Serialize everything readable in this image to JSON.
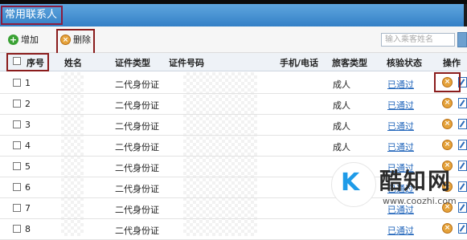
{
  "window": {
    "title": "常用联系人"
  },
  "toolbar": {
    "add_label": "增加",
    "delete_label": "删除",
    "search_placeholder": "输入乘客姓名"
  },
  "table": {
    "headers": {
      "seq": "序号",
      "name": "姓名",
      "id_type": "证件类型",
      "id_number": "证件号码",
      "phone": "手机/电话",
      "passenger_type": "旅客类型",
      "status": "核验状态",
      "action": "操作"
    },
    "rows": [
      {
        "seq": "1",
        "id_type": "二代身份证",
        "passenger_type": "成人",
        "status": "已通过"
      },
      {
        "seq": "2",
        "id_type": "二代身份证",
        "passenger_type": "成人",
        "status": "已通过"
      },
      {
        "seq": "3",
        "id_type": "二代身份证",
        "passenger_type": "成人",
        "status": "已通过"
      },
      {
        "seq": "4",
        "id_type": "二代身份证",
        "passenger_type": "成人",
        "status": "已通过"
      },
      {
        "seq": "5",
        "id_type": "二代身份证",
        "passenger_type": "",
        "status": "已通过"
      },
      {
        "seq": "6",
        "id_type": "二代身份证",
        "passenger_type": "",
        "status": "已通过"
      },
      {
        "seq": "7",
        "id_type": "二代身份证",
        "passenger_type": "",
        "status": "已通过"
      },
      {
        "seq": "8",
        "id_type": "二代身份证",
        "passenger_type": "",
        "status": "已通过"
      }
    ]
  },
  "watermark": {
    "logo_letter": "K",
    "name": "酷知网",
    "url": "www.coozhi.com"
  },
  "colors": {
    "title_bar": "#3480c6",
    "link": "#2266bb",
    "highlight_box": "#8a1c1c"
  },
  "icons": {
    "add": "plus-circle-icon",
    "delete": "x-circle-icon",
    "edit": "edit-icon"
  }
}
